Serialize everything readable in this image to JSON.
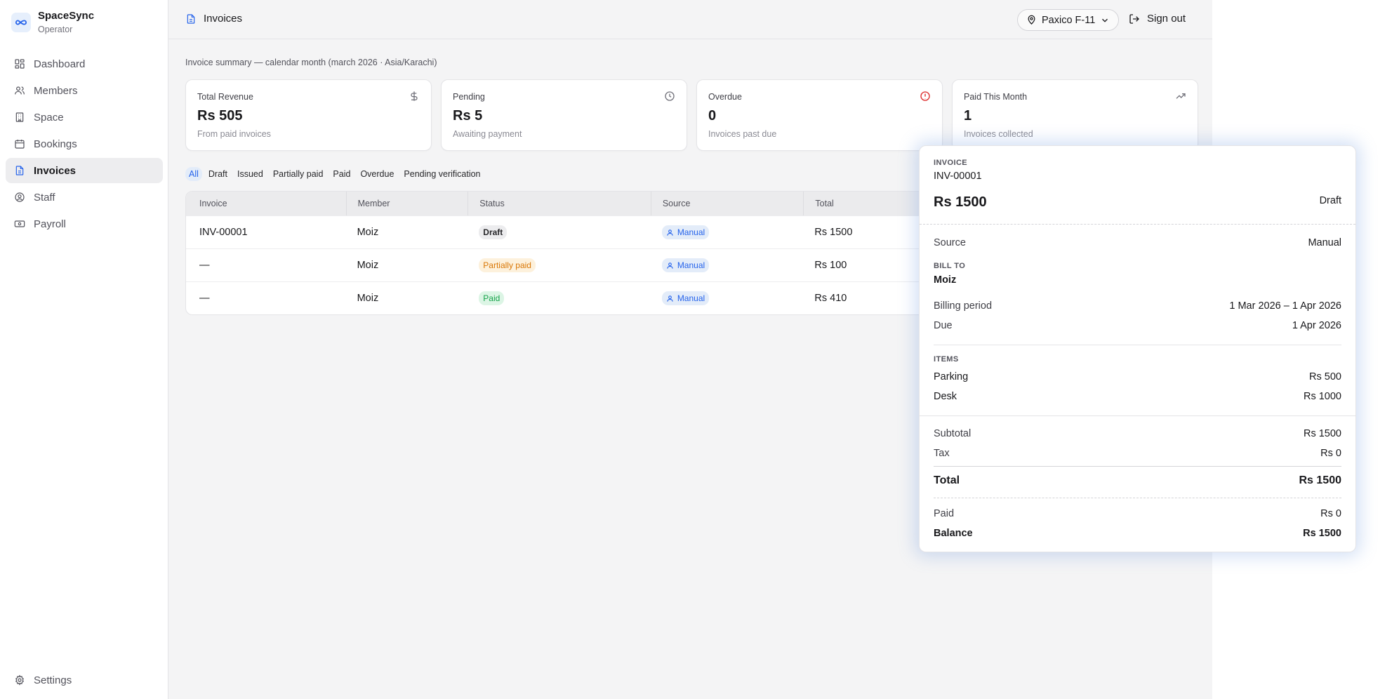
{
  "app": {
    "name": "SpaceSync",
    "role": "Operator"
  },
  "sidebar": {
    "items": [
      {
        "label": "Dashboard",
        "icon": "grid-icon",
        "active": false
      },
      {
        "label": "Members",
        "icon": "users-icon",
        "active": false
      },
      {
        "label": "Space",
        "icon": "building-icon",
        "active": false
      },
      {
        "label": "Bookings",
        "icon": "calendar-icon",
        "active": false
      },
      {
        "label": "Invoices",
        "icon": "file-text-icon",
        "active": true
      },
      {
        "label": "Staff",
        "icon": "user-circle-icon",
        "active": false
      },
      {
        "label": "Payroll",
        "icon": "banknote-icon",
        "active": false
      }
    ],
    "settings": "Settings"
  },
  "header": {
    "title": "Invoices",
    "location": "Paxico F-11",
    "signout": "Sign out"
  },
  "summary": {
    "caption": "Invoice summary — calendar month (march 2026 · Asia/Karachi)",
    "cards": [
      {
        "label": "Total Revenue",
        "value": "Rs 505",
        "sub": "From paid invoices",
        "icon": "dollar-icon"
      },
      {
        "label": "Pending",
        "value": "Rs 5",
        "sub": "Awaiting payment",
        "icon": "clock-icon"
      },
      {
        "label": "Overdue",
        "value": "0",
        "sub": "Invoices past due",
        "icon": "alert-circle-icon",
        "icon_color": "#dc2626"
      },
      {
        "label": "Paid This Month",
        "value": "1",
        "sub": "Invoices collected",
        "icon": "trending-up-icon"
      }
    ]
  },
  "filters": [
    "All",
    "Draft",
    "Issued",
    "Partially paid",
    "Paid",
    "Overdue",
    "Pending verification"
  ],
  "table": {
    "columns": [
      "Invoice",
      "Member",
      "Status",
      "Source",
      "Total"
    ],
    "rows": [
      {
        "invoice": "INV-00001",
        "member": "Moiz",
        "status": "Draft",
        "source": "Manual",
        "total": "Rs 1500"
      },
      {
        "invoice": "—",
        "member": "Moiz",
        "status": "Partially paid",
        "source": "Manual",
        "total": "Rs 100"
      },
      {
        "invoice": "—",
        "member": "Moiz",
        "status": "Paid",
        "source": "Manual",
        "total": "Rs 410"
      }
    ]
  },
  "popover": {
    "kicker": "INVOICE",
    "id": "INV-00001",
    "amount": "Rs 1500",
    "status": "Draft",
    "source_label": "Source",
    "source_value": "Manual",
    "bill_to_label": "BILL TO",
    "bill_to_value": "Moiz",
    "billing_period_label": "Billing period",
    "billing_period_value": "1 Mar 2026 – 1 Apr 2026",
    "due_label": "Due",
    "due_value": "1 Apr 2026",
    "items_label": "ITEMS",
    "items": [
      {
        "name": "Parking",
        "amount": "Rs 500"
      },
      {
        "name": "Desk",
        "amount": "Rs 1000"
      }
    ],
    "subtotal_label": "Subtotal",
    "subtotal_value": "Rs 1500",
    "tax_label": "Tax",
    "tax_value": "Rs 0",
    "total_label": "Total",
    "total_value": "Rs 1500",
    "paid_label": "Paid",
    "paid_value": "Rs 0",
    "balance_label": "Balance",
    "balance_value": "Rs 1500"
  },
  "colors": {
    "accent": "#2563eb",
    "overdue": "#dc2626",
    "partial": "#d97706",
    "paid": "#16a34a"
  }
}
